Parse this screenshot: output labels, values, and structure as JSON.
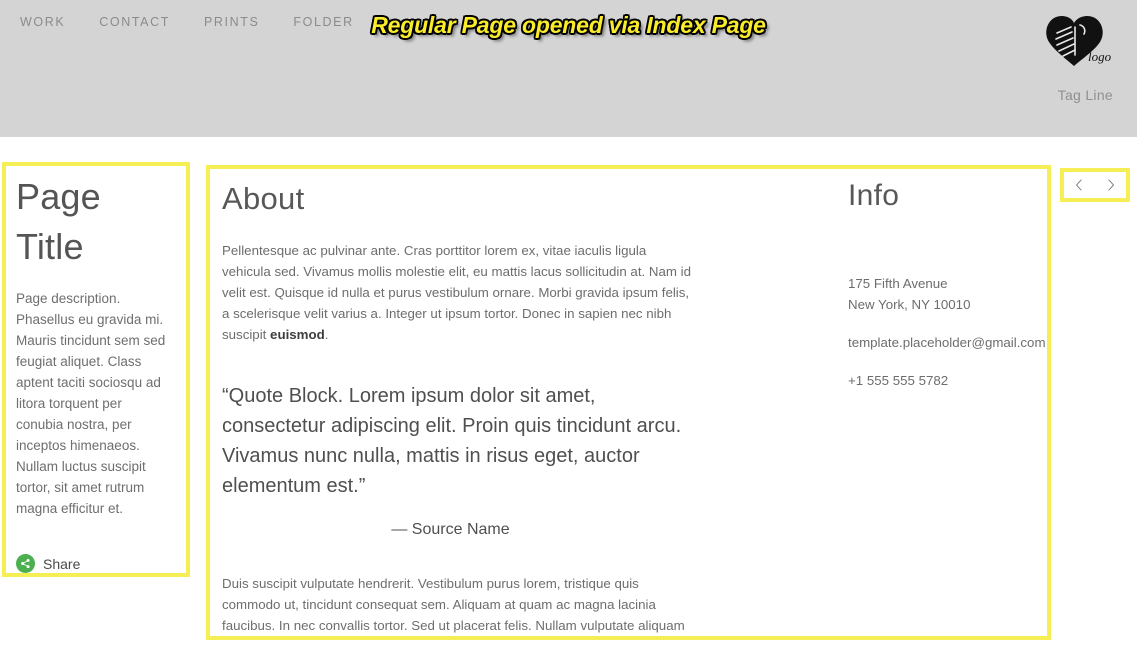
{
  "header": {
    "nav_items": [
      {
        "label": "WORK"
      },
      {
        "label": "CONTACT"
      },
      {
        "label": "PRINTS"
      },
      {
        "label": "FOLDER"
      }
    ],
    "banner_title": "Regular Page opened via Index Page",
    "banner_text_color": "#fbec2a",
    "banner_outline_color": "#000000",
    "background_color": "#d4d4d4",
    "logo_alt": "logo",
    "logo_word": "logo",
    "tagline": "Tag Line"
  },
  "highlight": {
    "color": "#f5ef55"
  },
  "left_column": {
    "title": "Page Title",
    "description": "Page description. Phasellus eu gravida mi. Mauris tincidunt sem sed feugiat aliquet. Class aptent taciti sociosqu ad litora torquent per conubia nostra, per inceptos himenaeos. Nullam luctus suscipit tortor, sit amet rutrum magna efficitur et.",
    "share_label": "Share",
    "share_icon_color": "#4caf50"
  },
  "main": {
    "heading": "About",
    "paragraph_1_pre": "Pellentesque ac pulvinar ante. Cras porttitor lorem ex, vitae iaculis ligula vehicula sed. Vivamus mollis molestie elit, eu mattis lacus sollicitudin at. Nam id velit est. Quisque id nulla et purus vestibulum ornare. Morbi gravida ipsum felis, a scelerisque velit varius a. Integer ut ipsum tortor. Donec in sapien nec nibh suscipit ",
    "paragraph_1_bold": "euismod",
    "paragraph_1_post": ".",
    "quote": "“Quote Block. Lorem ipsum dolor sit amet, consectetur adipiscing elit. Proin quis tincidunt arcu. Vivamus nunc nulla, mattis in risus eget, auctor elementum est.”",
    "quote_source": "— Source Name",
    "paragraph_2": "Duis suscipit vulputate hendrerit. Vestibulum purus lorem, tristique quis commodo ut, tincidunt consequat sem. Aliquam at quam ac magna lacinia faucibus. In nec convallis tortor. Sed ut placerat felis. Nullam vulputate aliquam"
  },
  "info": {
    "heading": "Info",
    "address_line_1": "175 Fifth Avenue",
    "address_line_2": "New York, NY 10010",
    "email": "template.placeholder@gmail.com",
    "phone": "+1 555 555 5782"
  },
  "pager": {
    "prev_icon": "chevron-left",
    "next_icon": "chevron-right"
  }
}
